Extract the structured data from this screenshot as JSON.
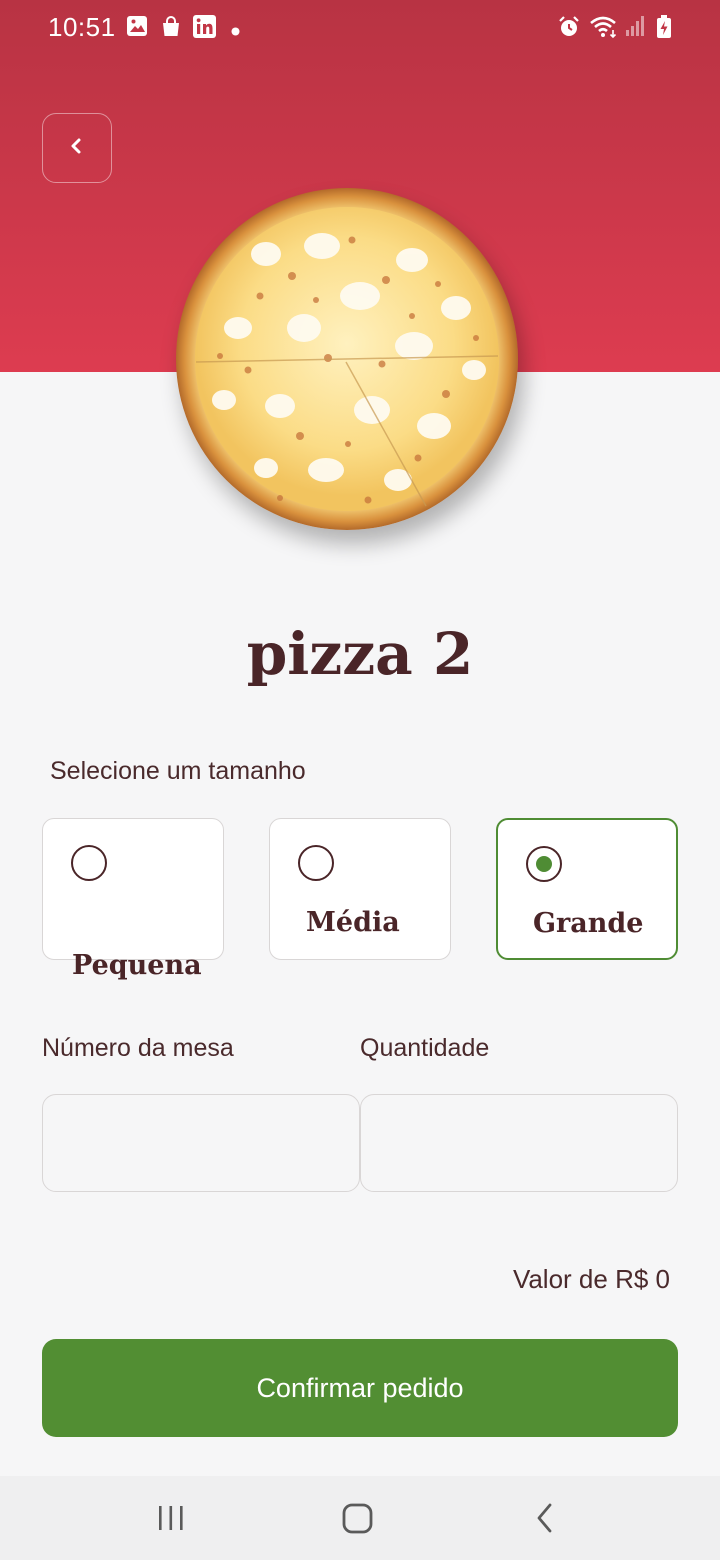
{
  "status_bar": {
    "time": "10:51",
    "left_icons": [
      "image-icon",
      "shopping-bag-icon",
      "linkedin-icon",
      "notification-dot-icon"
    ],
    "right_icons": [
      "alarm-icon",
      "wifi-icon",
      "signal-icon",
      "battery-charging-icon"
    ]
  },
  "header": {
    "back_icon": "chevron-left-icon",
    "colors": {
      "gradient_top": "#b83343",
      "gradient_bottom": "#dd3c50"
    }
  },
  "product": {
    "name": "pizza 2",
    "image": "pizza-image"
  },
  "size_selector": {
    "label": "Selecione um tamanho",
    "options": [
      {
        "label": "Pequena",
        "selected": false
      },
      {
        "label": "Média",
        "selected": false
      },
      {
        "label": "Grande",
        "selected": true
      }
    ]
  },
  "form": {
    "table_number": {
      "label": "Número da mesa",
      "value": "",
      "placeholder": ""
    },
    "quantity": {
      "label": "Quantidade",
      "value": "",
      "placeholder": ""
    }
  },
  "total": {
    "text": "Valor de R$ 0"
  },
  "confirm_button": {
    "label": "Confirmar pedido",
    "color": "#528e33"
  },
  "nav_bar": {
    "buttons": [
      "recent-apps-icon",
      "home-icon",
      "back-icon"
    ]
  }
}
